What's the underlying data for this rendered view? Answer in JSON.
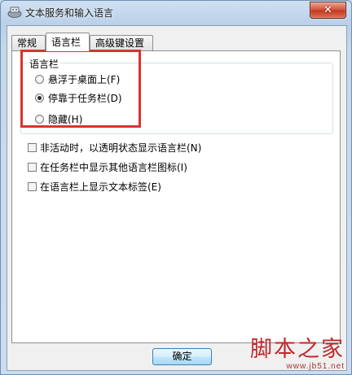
{
  "window": {
    "title": "文本服务和输入语言",
    "close_glyph": "✕"
  },
  "tabs": [
    {
      "label": "常规",
      "active": false
    },
    {
      "label": "语言栏",
      "active": true
    },
    {
      "label": "高级键设置",
      "active": false
    }
  ],
  "language_bar_group": {
    "legend": "语言栏",
    "options": [
      {
        "label": "悬浮于桌面上(F)",
        "checked": false
      },
      {
        "label": "停靠于任务栏(D)",
        "checked": true
      },
      {
        "label": "隐藏(H)",
        "checked": false
      }
    ]
  },
  "checkboxes": [
    {
      "label": "非活动时，以透明状态显示语言栏(N)",
      "checked": false
    },
    {
      "label": "在任务栏中显示其他语言栏图标(I)",
      "checked": false
    },
    {
      "label": "在语言栏上显示文本标签(E)",
      "checked": false
    }
  ],
  "buttons": {
    "ok_label": "确定"
  },
  "watermark": {
    "brand": "脚本之家",
    "url": "www.jb51.net"
  },
  "colors": {
    "annotation_red": "#d9342b",
    "watermark_red": "#c0282b"
  }
}
